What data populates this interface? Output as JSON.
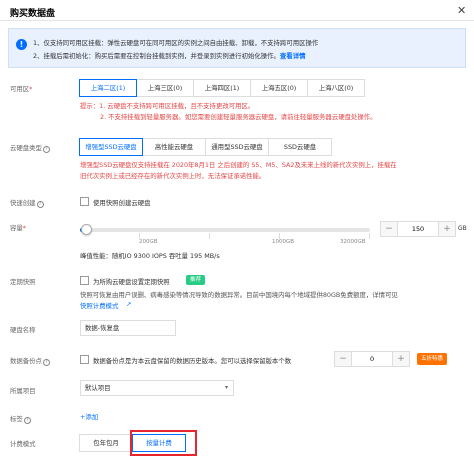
{
  "dialog": {
    "title": "购买数据盘",
    "close": "✕"
  },
  "notice": {
    "line1": "1、仅支持同可用区挂载：弹性云硬盘可在同可用区的实例之间自由挂载、卸载，不支持跨可用区操作",
    "line2": "2、挂载后需初始化：购买后需要在控制台挂载到实例，并登录到实例进行初始化操作。",
    "link": "查看详情"
  },
  "zone": {
    "label": "可用区",
    "options": [
      "上海二区(1)",
      "上海三区(0)",
      "上海四区(1)",
      "上海五区(0)",
      "上海八区(0)"
    ],
    "selected": 0,
    "warn1": "提示：1. 云硬盘不支持跨可用区挂载，且不支持更改可用区。",
    "warn2": "2. 不支持挂载到轻量服务器。如您需要创建轻量服务器云硬盘，请前往轻量服务器云硬盘处操作。"
  },
  "disk_type": {
    "label": "云硬盘类型",
    "options": [
      "增强型SSD云硬盘",
      "高性能云硬盘",
      "通用型SSD云硬盘",
      "SSD云硬盘"
    ],
    "selected": 0,
    "warn1": "增强型SSD云硬盘仅支持挂载在 2020年8月1日 之后创建的 S5、M5、SA2及未来上线的新代次实例上，挂载在",
    "warn2": "旧代次实例上或已经存在的新代次实例上时，无法保证承诺性能。"
  },
  "snapshot": {
    "label": "快速创建",
    "checkbox": "使用快照创建云硬盘"
  },
  "capacity": {
    "label": "容量",
    "ticks": [
      "200GB",
      "1000GB",
      "32000GB"
    ],
    "value": "150",
    "minus": "−",
    "plus": "+",
    "unit": "GB",
    "slider_fraction": 0.02,
    "perf": "峰值性能：随机IO 9300 IOPS 吞吐量 195 MB/s"
  },
  "scheduled_snapshot": {
    "label": "定期快照",
    "checkbox": "为所购云硬盘设置定期快照",
    "badge": "推荐",
    "desc1": "快照可恢复由用户误删、病毒感染等情况导致的数据异常。目前中国境内每个地域提供80GB免费额度，详情可见",
    "link": "快照计费模式"
  },
  "disk_name": {
    "label": "硬盘名称",
    "value": "数据-恢复盘"
  },
  "backup": {
    "label": "数据备份点",
    "checkbox": "数据备份点是为本云盘保留的数据历史版本。您可以选择保留版本个数",
    "value": "0",
    "minus": "−",
    "plus": "+",
    "badge": "五折特惠"
  },
  "project": {
    "label": "所属项目",
    "value": "默认项目",
    "caret": "▾"
  },
  "tags": {
    "label": "标签",
    "add": "+添加"
  },
  "billing": {
    "label": "计费模式",
    "options": [
      "包年包月",
      "按量计费"
    ],
    "selected": 1
  },
  "colors": {
    "accent": "#006eff",
    "warn": "#e54545",
    "highlight": "#e8242c",
    "green": "#29cc85",
    "orange": "#ff7200"
  }
}
